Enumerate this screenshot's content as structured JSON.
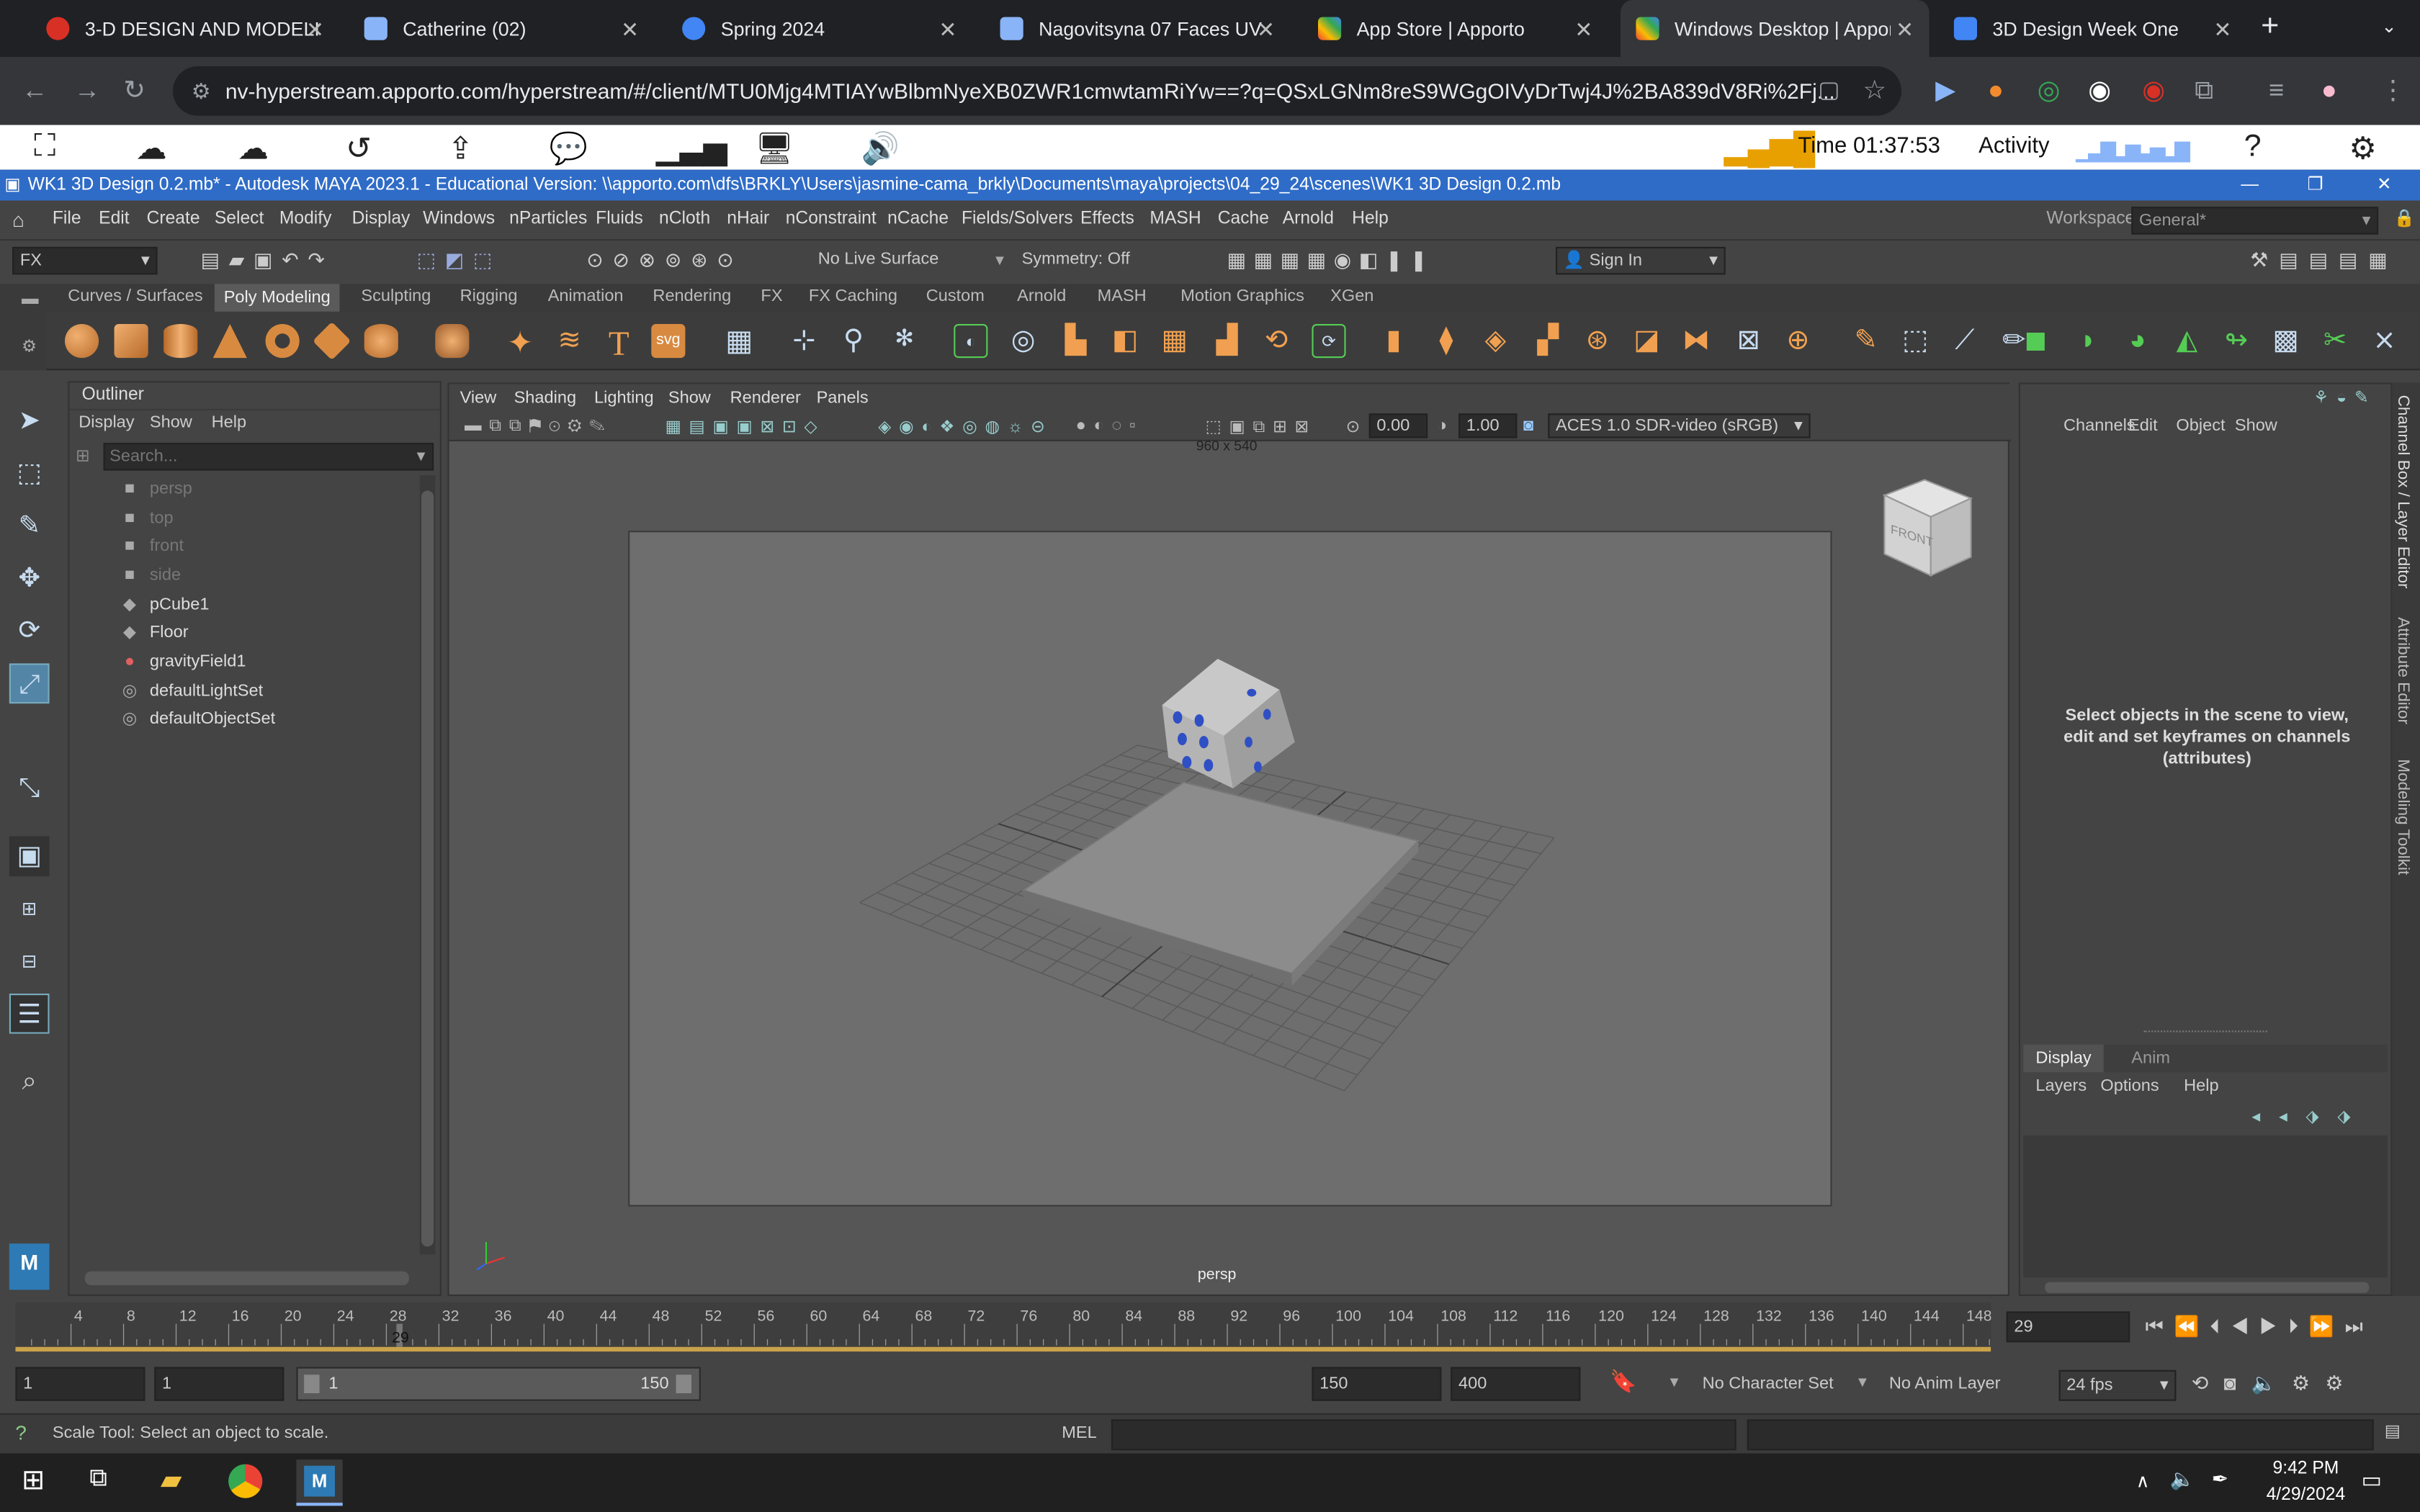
{
  "browser": {
    "tabs": [
      {
        "title": "3-D DESIGN AND MODELI",
        "color": "#d93025"
      },
      {
        "title": "Catherine (02)",
        "color": "#8ab4f8"
      },
      {
        "title": "Spring 2024",
        "color": "#4285f4"
      },
      {
        "title": "Nagovitsyna 07 Faces UV",
        "color": "#8ab4f8"
      },
      {
        "title": "App Store | Apporto",
        "color": "#fbbc04"
      },
      {
        "title": "Windows Desktop | Appor",
        "color": "#34a853"
      },
      {
        "title": "3D Design Week One",
        "color": "#4285f4"
      }
    ],
    "url": "nv-hyperstream.apporto.com/hyperstream/#/client/MTU0Mjg4MTIAYwBlbmNyeXB0ZWR1cmwtamRiYw==?q=QSxLGNm8reS9WGgOIVyDrTwj4J%2BA839dV8Ri%2Fj..."
  },
  "apporto": {
    "time": "Time 01:37:53",
    "activity": "Activity"
  },
  "maya": {
    "title": "WK1 3D Design 0.2.mb* - Autodesk MAYA 2023.1 - Educational Version: \\\\apporto.com\\dfs\\BRKLY\\Users\\jasmine-cama_brkly\\Documents\\maya\\projects\\04_29_24\\scenes\\WK1 3D Design 0.2.mb",
    "menu": [
      "File",
      "Edit",
      "Create",
      "Select",
      "Modify",
      "Display",
      "Windows",
      "nParticles",
      "Fluids",
      "nCloth",
      "nHair",
      "nConstraint",
      "nCache",
      "Fields/Solvers",
      "Effects",
      "MASH",
      "Cache",
      "Arnold",
      "Help"
    ],
    "workspace_label": "Workspace:",
    "workspace": "General*",
    "menuset": "FX",
    "live_surface": "No Live Surface",
    "symmetry": "Symmetry: Off",
    "sign_in": "Sign In",
    "shelf_tabs": [
      "Curves / Surfaces",
      "Poly Modeling",
      "Sculpting",
      "Rigging",
      "Animation",
      "Rendering",
      "FX",
      "FX Caching",
      "Custom",
      "Arnold",
      "MASH",
      "Motion Graphics",
      "XGen"
    ],
    "shelf_svg": "svg",
    "outliner": {
      "title": "Outliner",
      "menu": [
        "Display",
        "Show",
        "Help"
      ],
      "search_placeholder": "Search...",
      "items": [
        {
          "name": "persp",
          "dim": true
        },
        {
          "name": "top",
          "dim": true
        },
        {
          "name": "front",
          "dim": true
        },
        {
          "name": "side",
          "dim": true
        },
        {
          "name": "pCube1",
          "dim": false
        },
        {
          "name": "Floor",
          "dim": false
        },
        {
          "name": "gravityField1",
          "dim": false
        },
        {
          "name": "defaultLightSet",
          "dim": false
        },
        {
          "name": "defaultObjectSet",
          "dim": false
        }
      ]
    },
    "viewport": {
      "menu": [
        "View",
        "Shading",
        "Lighting",
        "Show",
        "Renderer",
        "Panels"
      ],
      "exposure": "0.00",
      "gamma": "1.00",
      "colorspace": "ACES 1.0 SDR-video (sRGB)",
      "resolution": "960 x 540",
      "camera": "persp",
      "cube_label": "FRONT"
    },
    "channel_box": {
      "menu": [
        "Channels",
        "Edit",
        "Object",
        "Show"
      ],
      "message": "Select objects in the scene to view, edit and set keyframes on channels (attributes)",
      "layer_tabs": [
        "Display",
        "Anim"
      ],
      "layer_menu": [
        "Layers",
        "Options",
        "Help"
      ],
      "side_tabs": [
        "Channel Box / Layer Editor",
        "Attribute Editor",
        "Modeling Toolkit"
      ]
    },
    "timeline": {
      "ticks": [
        "4",
        "8",
        "12",
        "16",
        "20",
        "24",
        "28",
        "32",
        "36",
        "40",
        "44",
        "48",
        "52",
        "56",
        "60",
        "64",
        "68",
        "72",
        "76",
        "80",
        "84",
        "88",
        "92",
        "96",
        "100",
        "104",
        "108",
        "112",
        "116",
        "120",
        "124",
        "128",
        "132",
        "136",
        "140",
        "144",
        "148"
      ],
      "current": "29",
      "current_field": "29"
    },
    "range": {
      "start": "1",
      "playback_start": "1",
      "slider_start": "1",
      "slider_end": "150",
      "playback_end": "150",
      "end": "400",
      "character_set": "No Character Set",
      "anim_layer": "No Anim Layer",
      "fps": "24 fps"
    },
    "help_line": "Scale Tool: Select an object to scale.",
    "mel": "MEL"
  },
  "taskbar": {
    "time": "9:42 PM",
    "date": "4/29/2024"
  }
}
